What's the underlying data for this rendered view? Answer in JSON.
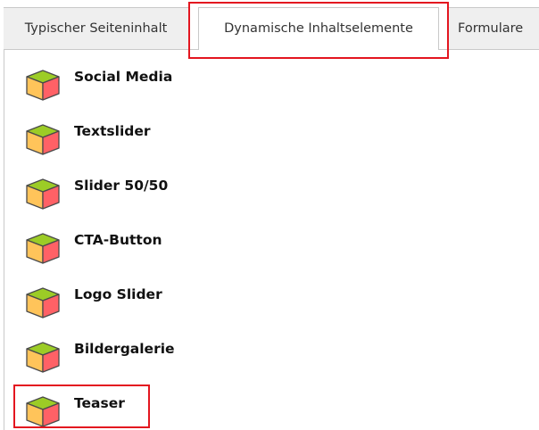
{
  "tabs": [
    {
      "label": "Typischer Seiteninhalt",
      "active": false
    },
    {
      "label": "Dynamische Inhaltselemente",
      "active": true
    },
    {
      "label": "Formulare",
      "active": false
    }
  ],
  "items": [
    {
      "label": "Social Media",
      "icon": "content-element-cube-icon"
    },
    {
      "label": "Textslider",
      "icon": "content-element-cube-icon"
    },
    {
      "label": "Slider 50/50",
      "icon": "content-element-cube-icon"
    },
    {
      "label": "CTA-Button",
      "icon": "content-element-cube-icon"
    },
    {
      "label": "Logo Slider",
      "icon": "content-element-cube-icon"
    },
    {
      "label": "Bildergalerie",
      "icon": "content-element-cube-icon"
    },
    {
      "label": "Teaser",
      "icon": "content-element-cube-icon"
    }
  ],
  "colors": {
    "highlight": "#e3161f",
    "cube_top": "#9ccc26",
    "cube_left": "#ffc45a",
    "cube_right": "#ff6166",
    "tab_inactive_bg": "#efefef",
    "tab_border": "#c9c9c9"
  }
}
